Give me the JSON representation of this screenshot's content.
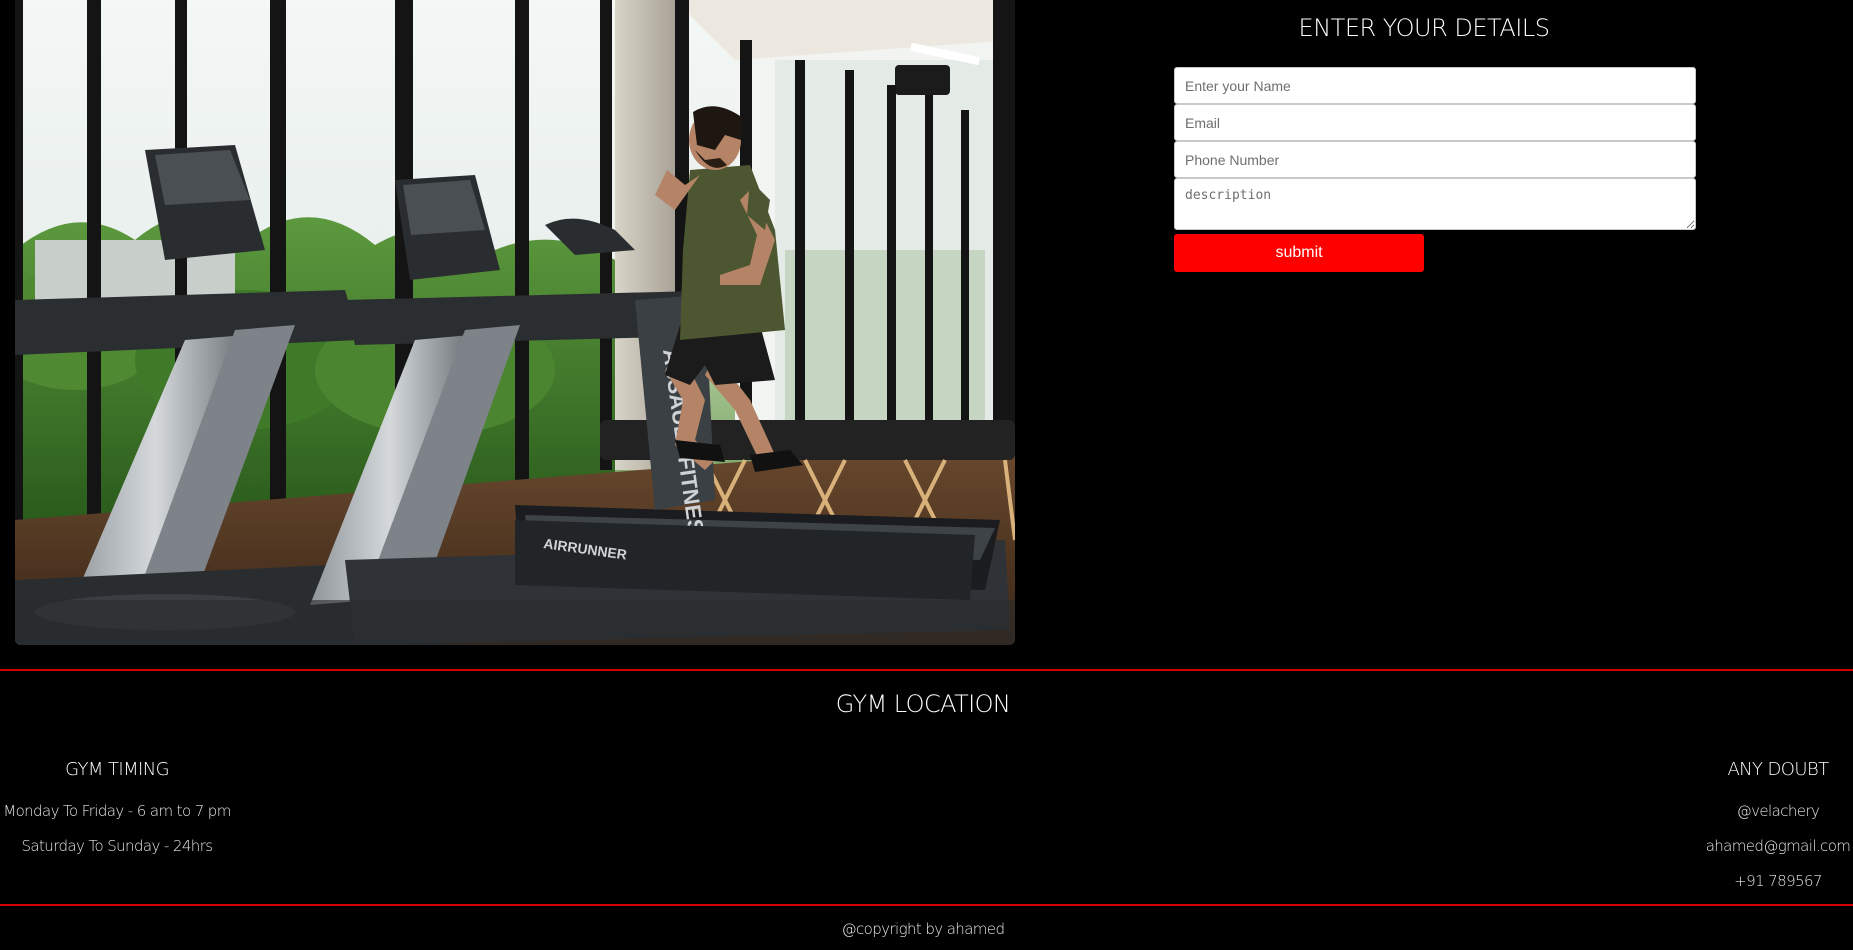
{
  "hero": {
    "image_alt": "Man running on a treadmill in a gym",
    "treadmill_brand": "ASSAULT FITNESS",
    "treadmill_model": "AIRRUNNER"
  },
  "form": {
    "title": "ENTER YOUR DETAILS",
    "name_placeholder": "Enter your Name",
    "email_placeholder": "Email",
    "phone_placeholder": "Phone Number",
    "description_placeholder": "description",
    "submit_label": "submit"
  },
  "footer": {
    "title": "GYM LOCATION",
    "timing": {
      "heading": "GYM TIMING",
      "lines": [
        "Monday To Friday - 6 am to 7 pm",
        "Saturday To Sunday - 24hrs"
      ]
    },
    "contact": {
      "heading": "ANY DOUBT",
      "lines": [
        "@velachery",
        "ahamed@gmail.com",
        "+91 789567"
      ]
    },
    "copyright": "@copyright by ahamed"
  },
  "colors": {
    "background": "#000000",
    "accent": "#ff0000",
    "divider": "#d40000",
    "text": "#ffffff"
  }
}
